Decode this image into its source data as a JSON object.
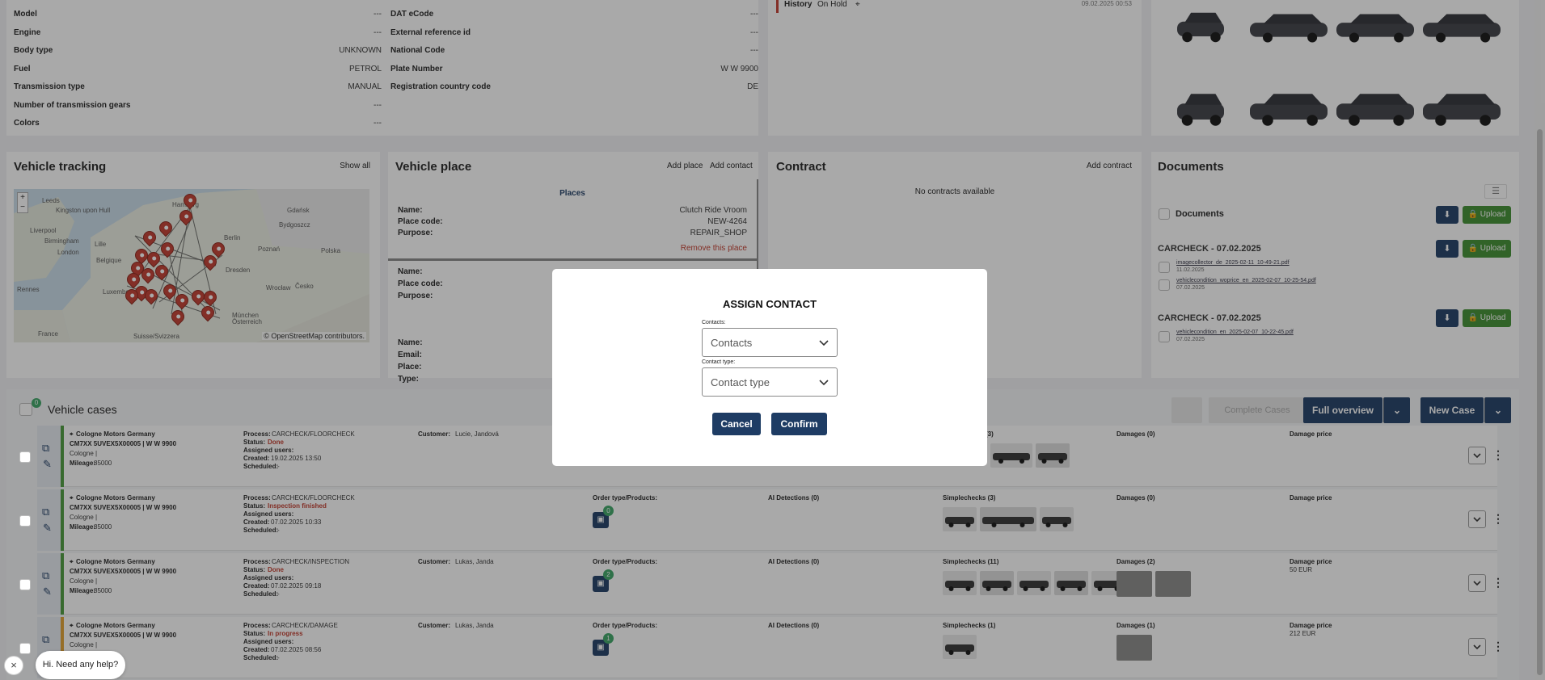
{
  "vehicle_info": {
    "left": [
      {
        "k": "Model",
        "v": "---"
      },
      {
        "k": "Engine",
        "v": "---"
      },
      {
        "k": "Body type",
        "v": "UNKNOWN"
      },
      {
        "k": "Fuel",
        "v": "PETROL"
      },
      {
        "k": "Transmission type",
        "v": "MANUAL"
      },
      {
        "k": "Number of transmission gears",
        "v": "---"
      },
      {
        "k": "Colors",
        "v": "---"
      }
    ],
    "right": [
      {
        "k": "DAT eCode",
        "v": "---"
      },
      {
        "k": "External reference id",
        "v": "---"
      },
      {
        "k": "National Code",
        "v": "---"
      },
      {
        "k": "Plate Number",
        "v": "W W 9900"
      },
      {
        "k": "Registration country code",
        "v": "DE"
      }
    ]
  },
  "history": {
    "label": "History",
    "status": "On Hold",
    "time": "09.02.2025 00:53"
  },
  "tracking": {
    "title": "Vehicle tracking",
    "show_all": "Show all",
    "attribution": "© OpenStreetMap contributors.",
    "zoom_in": "+",
    "zoom_out": "−",
    "cities": [
      "Leeds",
      "Kingston upon Hull",
      "Liverpool",
      "Birmingham",
      "London",
      "Lille",
      "Belgique",
      "Luxembourg",
      "Rennes",
      "France",
      "Suisse/Svizzera",
      "Hamburg",
      "Berlin",
      "Dresden",
      "Gdańsk",
      "Bydgoszcz",
      "Poznań",
      "Polska",
      "Wrocław",
      "Česko",
      "Österreich",
      "München"
    ]
  },
  "place": {
    "title": "Vehicle place",
    "add_place": "Add place",
    "add_contact": "Add contact",
    "places_header": "Places",
    "place1": [
      {
        "k": "Name:",
        "v": "Clutch Ride Vroom"
      },
      {
        "k": "Place code:",
        "v": "NEW-4264"
      },
      {
        "k": "Purpose:",
        "v": "REPAIR_SHOP"
      }
    ],
    "remove": "Remove this place",
    "place2": [
      "Name:",
      "Place code:",
      "Purpose:"
    ],
    "contact": [
      "Name:",
      "Email:",
      "Place:",
      "Type:"
    ]
  },
  "contract": {
    "title": "Contract",
    "add": "Add contract",
    "empty": "No contracts available"
  },
  "documents": {
    "title": "Documents",
    "root_label": "Documents",
    "upload": "Upload",
    "groups": [
      {
        "title": "CARCHECK - 07.02.2025",
        "files": [
          {
            "name": "imagecollector_de_2025-02-11_10-49-21.pdf",
            "date": "11.02.2025"
          },
          {
            "name": "vehiclecondition_woprice_en_2025-02-07_10-25-54.pdf",
            "date": "07.02.2025"
          }
        ]
      },
      {
        "title": "CARCHECK - 07.02.2025",
        "files": [
          {
            "name": "vehiclecondition_en_2025-02-07_10-22-45.pdf",
            "date": "07.02.2025"
          }
        ]
      }
    ]
  },
  "cases": {
    "title": "Vehicle cases",
    "count": "0",
    "complete_label": "Complete Cases",
    "full_overview": "Full overview",
    "new_case": "New Case",
    "rows": [
      {
        "org": "Cologne Motors Germany",
        "vin": "CM7XX 5UVEX5X00005 | W W 9900",
        "city": "Cologne |",
        "mileage_label": "Mileage:",
        "mileage": "85000",
        "process": "CARCHECK/FLOORCHECK",
        "status": "Done",
        "created": "19.02.2025 13:50",
        "scheduled": "-",
        "customer": "Lucie, Jandová",
        "order_count": "",
        "ai": "",
        "simple": "(3)",
        "damages": "Damages (0)",
        "damage_price": "",
        "accent": "#4a9a3a"
      },
      {
        "org": "Cologne Motors Germany",
        "vin": "CM7XX 5UVEX5X00005 | W W 9900",
        "city": "Cologne |",
        "mileage_label": "Mileage:",
        "mileage": "85000",
        "process": "CARCHECK/FLOORCHECK",
        "status": "Inspection finished",
        "created": "07.02.2025 10:33",
        "scheduled": "-",
        "customer": "",
        "order_count": "0",
        "ai": "AI Detections (0)",
        "simple": "Simplechecks (3)",
        "damages": "Damages (0)",
        "damage_price": "",
        "accent": "#4a9a3a"
      },
      {
        "org": "Cologne Motors Germany",
        "vin": "CM7XX 5UVEX5X00005 | W W 9900",
        "city": "Cologne |",
        "mileage_label": "Mileage:",
        "mileage": "85000",
        "process": "CARCHECK/INSPECTION",
        "status": "Done",
        "created": "07.02.2025 09:18",
        "scheduled": "-",
        "customer": "Lukas, Janda",
        "order_count": "2",
        "ai": "AI Detections (0)",
        "simple": "Simplechecks (11)",
        "damages": "Damages (2)",
        "damage_price": "50 EUR",
        "accent": "#4a9a3a"
      },
      {
        "org": "Cologne Motors Germany",
        "vin": "CM7XX 5UVEX5X00005 | W W 9900",
        "city": "Cologne |",
        "mileage_label": "",
        "mileage": "",
        "process": "CARCHECK/DAMAGE",
        "status": "In progress",
        "created": "07.02.2025 08:56",
        "scheduled": "-",
        "customer": "Lukas, Janda",
        "order_count": "1",
        "ai": "AI Detections (0)",
        "simple": "Simplechecks (1)",
        "damages": "Damages (1)",
        "damage_price": "212 EUR",
        "accent": "#e0a030"
      }
    ],
    "labels": {
      "process": "Process:",
      "status": "Status:",
      "assigned": "Assigned users:",
      "created": "Created:",
      "scheduled": "Scheduled:",
      "customer": "Customer:",
      "order": "Order type/Products:",
      "damage_price": "Damage price"
    }
  },
  "modal": {
    "title": "ASSIGN CONTACT",
    "contacts_label": "Contacts:",
    "contacts_placeholder": "Contacts",
    "type_label": "Contact type:",
    "type_placeholder": "Contact type",
    "cancel": "Cancel",
    "confirm": "Confirm"
  },
  "chat": {
    "text": "Hi. Need any help?",
    "close": "×"
  }
}
